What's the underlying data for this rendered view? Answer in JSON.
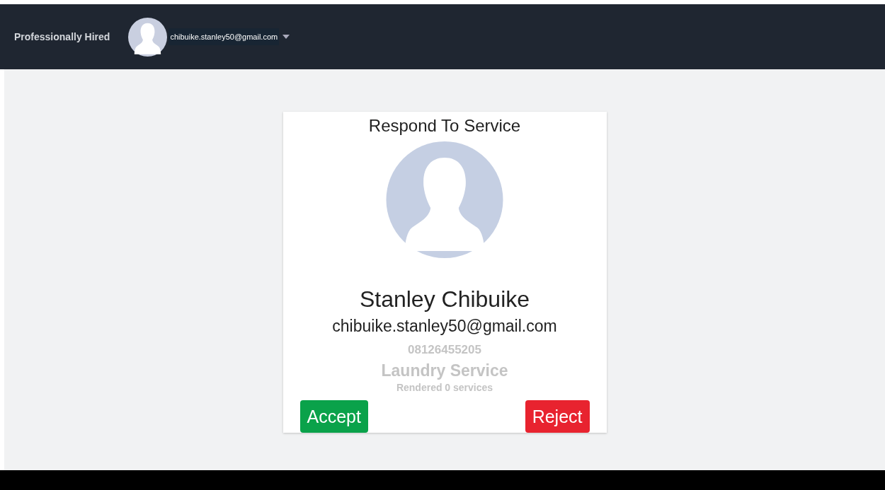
{
  "navbar": {
    "brand": "Professionally Hired",
    "user_email": "chibuike.stanley50@gmail.com"
  },
  "card": {
    "title": "Respond To Service",
    "name": "Stanley Chibuike",
    "email": "chibuike.stanley50@gmail.com",
    "phone": "08126455205",
    "service": "Laundry Service",
    "rendered": "Rendered 0 services",
    "buttons": [
      {
        "label": "Accept",
        "kind": "accept"
      },
      {
        "label": "Reject",
        "kind": "reject"
      }
    ]
  }
}
